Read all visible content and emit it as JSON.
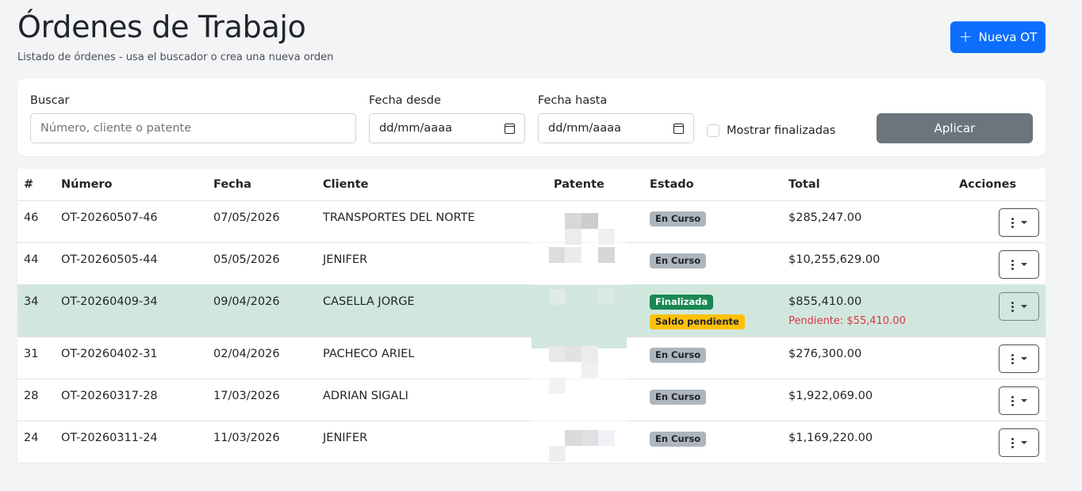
{
  "header": {
    "title": "Órdenes de Trabajo",
    "subtitle": "Listado de órdenes - usa el buscador o crea una nueva orden",
    "new_button": "Nueva OT"
  },
  "filters": {
    "search_label": "Buscar",
    "search_placeholder": "Número, cliente o patente",
    "date_from_label": "Fecha desde",
    "date_from_value": "dd/mm/aaaa",
    "date_to_label": "Fecha hasta",
    "date_to_value": "dd/mm/aaaa",
    "show_finished_label": "Mostrar finalizadas",
    "show_finished_checked": false,
    "apply_button": "Aplicar"
  },
  "table": {
    "headers": {
      "id": "#",
      "number": "Número",
      "date": "Fecha",
      "client": "Cliente",
      "plate": "Patente",
      "status": "Estado",
      "total": "Total",
      "actions": "Acciones"
    },
    "rows": [
      {
        "id": "46",
        "number": "OT-20260507-46",
        "date": "07/05/2026",
        "client": "TRANSPORTES DEL NORTE",
        "status": "En Curso",
        "total": "$285,247.00"
      },
      {
        "id": "44",
        "number": "OT-20260505-44",
        "date": "05/05/2026",
        "client": "JENIFER",
        "status": "En Curso",
        "total": "$10,255,629.00"
      },
      {
        "id": "34",
        "number": "OT-20260409-34",
        "date": "09/04/2026",
        "client": "CASELLA JORGE",
        "status": "Finalizada",
        "status_extra": "Saldo pendiente",
        "total": "$855,410.00",
        "pending": "Pendiente: $55,410.00"
      },
      {
        "id": "31",
        "number": "OT-20260402-31",
        "date": "02/04/2026",
        "client": "PACHECO ARIEL",
        "status": "En Curso",
        "total": "$276,300.00"
      },
      {
        "id": "28",
        "number": "OT-20260317-28",
        "date": "17/03/2026",
        "client": "ADRIAN SIGALI",
        "status": "En Curso",
        "total": "$1,922,069.00"
      },
      {
        "id": "24",
        "number": "OT-20260311-24",
        "date": "11/03/2026",
        "client": "JENIFER",
        "status": "En Curso",
        "total": "$1,169,220.00"
      }
    ]
  },
  "colors": {
    "primary": "#0d6efd",
    "secondary": "#6c757d",
    "success": "#198754",
    "warning": "#ffc107",
    "danger": "#dc3545",
    "highlight_row": "#d1e7dd"
  },
  "icons": {
    "new_button": "plus-icon",
    "date_inputs": "calendar-icon",
    "row_actions": "vertical-dots-icon"
  }
}
